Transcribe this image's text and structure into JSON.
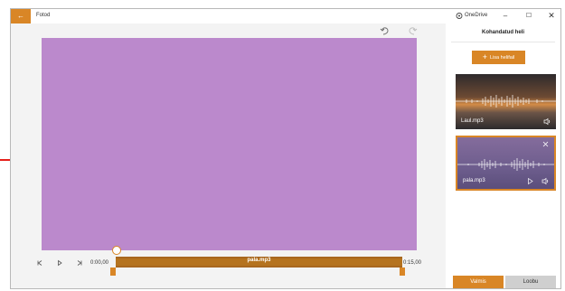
{
  "window": {
    "app_title": "Fotod",
    "back_glyph": "←",
    "onedrive_label": "OneDrive",
    "minimize_glyph": "–",
    "maximize_glyph": "☐",
    "close_glyph": "✕"
  },
  "editor": {
    "preview_color": "#bb89cc",
    "time_start": "0:00,00",
    "time_end": "0:15,00",
    "track_label": "pala.mp3",
    "playhead_fraction": 0.0
  },
  "panel": {
    "title": "Kohandatud heli",
    "add_button_label": "Lisa helifail",
    "add_button_plus": "+",
    "files": [
      {
        "name": "Laul.mp3"
      },
      {
        "name": "pala.mp3"
      }
    ],
    "done_label": "Valmis",
    "cancel_label": "Loobu"
  },
  "colors": {
    "accent": "#d98626",
    "track": "#a8671f"
  },
  "icons": [
    "back-arrow-icon",
    "onedrive-icon",
    "undo-icon",
    "redo-icon",
    "previous-frame-icon",
    "play-icon",
    "next-frame-icon",
    "volume-icon",
    "close-icon"
  ]
}
